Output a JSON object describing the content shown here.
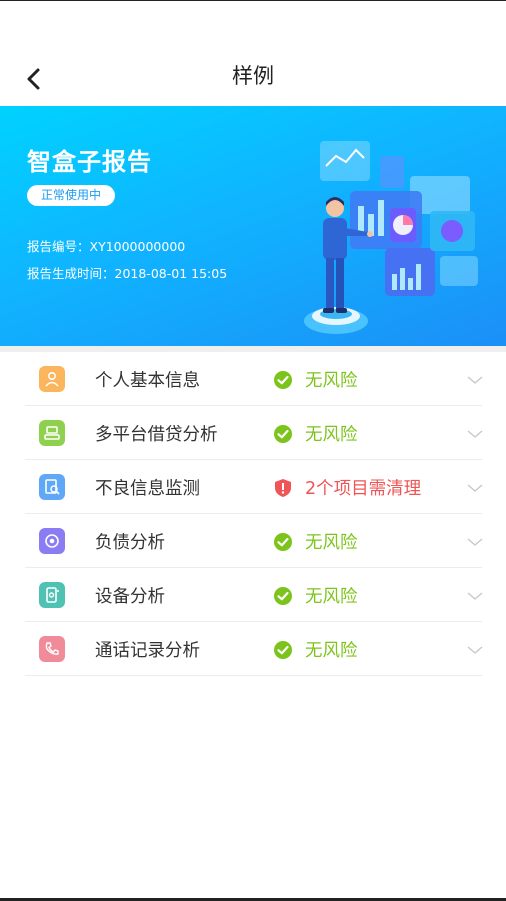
{
  "header": {
    "title": "样例"
  },
  "banner": {
    "title": "智盒子报告",
    "badge": "正常使用中",
    "report_no": "报告编号：XY1000000000",
    "report_time": "报告生成时间：2018-08-01 15:05"
  },
  "colors": {
    "banner_start": "#00d2ff",
    "banner_end": "#1b8ff7",
    "ok_green": "#7cc41c",
    "warn_red": "#ef5456"
  },
  "items": [
    {
      "label": "个人基本信息",
      "status": "无风险",
      "state": "ok",
      "icon": "person-icon",
      "icon_color": "#fbb55c"
    },
    {
      "label": "多平台借贷分析",
      "status": "无风险",
      "state": "ok",
      "icon": "platform-icon",
      "icon_color": "#8fd14f"
    },
    {
      "label": "不良信息监测",
      "status": "2个项目需清理",
      "state": "warn",
      "icon": "document-search-icon",
      "icon_color": "#5fa8f7"
    },
    {
      "label": "负债分析",
      "status": "无风险",
      "state": "ok",
      "icon": "debt-icon",
      "icon_color": "#8a7cf3"
    },
    {
      "label": "设备分析",
      "status": "无风险",
      "state": "ok",
      "icon": "device-icon",
      "icon_color": "#4fc2b4"
    },
    {
      "label": "通话记录分析",
      "status": "无风险",
      "state": "ok",
      "icon": "phone-icon",
      "icon_color": "#f08b9a"
    }
  ]
}
